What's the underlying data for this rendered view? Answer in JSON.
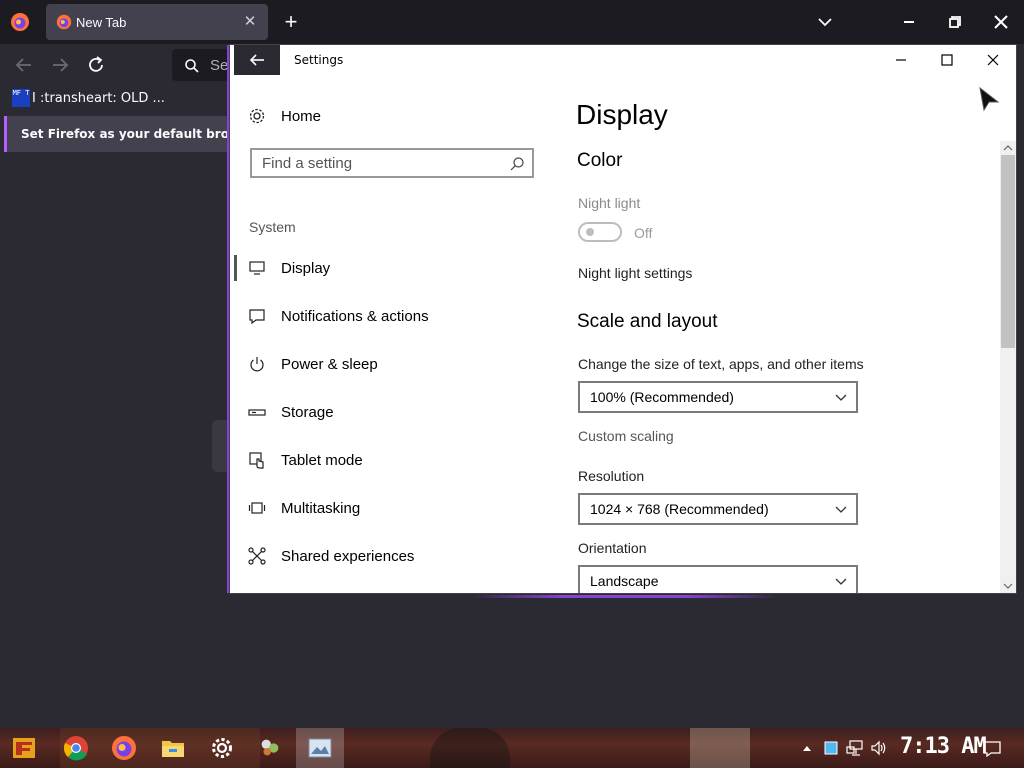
{
  "firefox": {
    "tab_title": "New Tab",
    "url_placeholder": "Se",
    "bookmark_label": "I :transheart: OLD ...",
    "bookmark_icon_text": "MF T",
    "notification_text": "Set Firefox as your default browser",
    "colors": {
      "toolbar": "#2b2a33",
      "tabstrip": "#1c1b22",
      "accent": "#b061ff"
    }
  },
  "settings": {
    "window_title": "Settings",
    "nav": {
      "home": "Home",
      "search_placeholder": "Find a setting",
      "section": "System",
      "items": [
        {
          "label": "Display",
          "icon": "monitor-icon",
          "active": true
        },
        {
          "label": "Notifications & actions",
          "icon": "notification-icon"
        },
        {
          "label": "Power & sleep",
          "icon": "power-icon"
        },
        {
          "label": "Storage",
          "icon": "storage-icon"
        },
        {
          "label": "Tablet mode",
          "icon": "tablet-mode-icon"
        },
        {
          "label": "Multitasking",
          "icon": "multitasking-icon"
        },
        {
          "label": "Shared experiences",
          "icon": "shared-experiences-icon"
        }
      ]
    },
    "content": {
      "title": "Display",
      "color_heading": "Color",
      "night_light_label": "Night light",
      "night_light_state": "Off",
      "night_light_settings": "Night light settings",
      "scale_heading": "Scale and layout",
      "scale_label": "Change the size of text, apps, and other items",
      "scale_value": "100% (Recommended)",
      "custom_scaling": "Custom scaling",
      "resolution_label": "Resolution",
      "resolution_value": "1024 × 768 (Recommended)",
      "orientation_label": "Orientation",
      "orientation_value": "Landscape"
    }
  },
  "taskbar": {
    "clock": "7:13 AM",
    "apps": [
      "start-icon",
      "chrome-icon",
      "firefox-icon",
      "file-explorer-icon",
      "settings-gear-icon",
      "app-icon",
      "photos-icon"
    ]
  }
}
